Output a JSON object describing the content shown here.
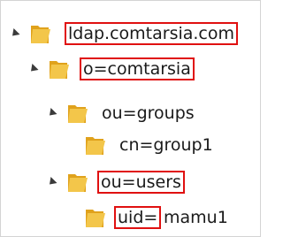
{
  "tree": {
    "root": {
      "label": "ldap.comtarsia.com",
      "expanded": true,
      "icon": "folder-icon",
      "children": [
        {
          "label": "o=comtarsia",
          "expanded": true,
          "icon": "folder-icon",
          "children": [
            {
              "label": "ou=groups",
              "expanded": true,
              "icon": "folder-icon",
              "children": [
                {
                  "label": "cn=group1",
                  "icon": "folder-icon"
                }
              ]
            },
            {
              "label": "ou=users",
              "expanded": true,
              "icon": "folder-icon",
              "children": [
                {
                  "label_key": "uid=",
                  "label_value": "mamu1",
                  "icon": "folder-icon"
                }
              ]
            }
          ]
        }
      ]
    }
  },
  "colors": {
    "highlight": "#e01010",
    "folder_front": "#f3c64a",
    "folder_back": "#e0a21c",
    "expander": "#3b3b3b"
  }
}
